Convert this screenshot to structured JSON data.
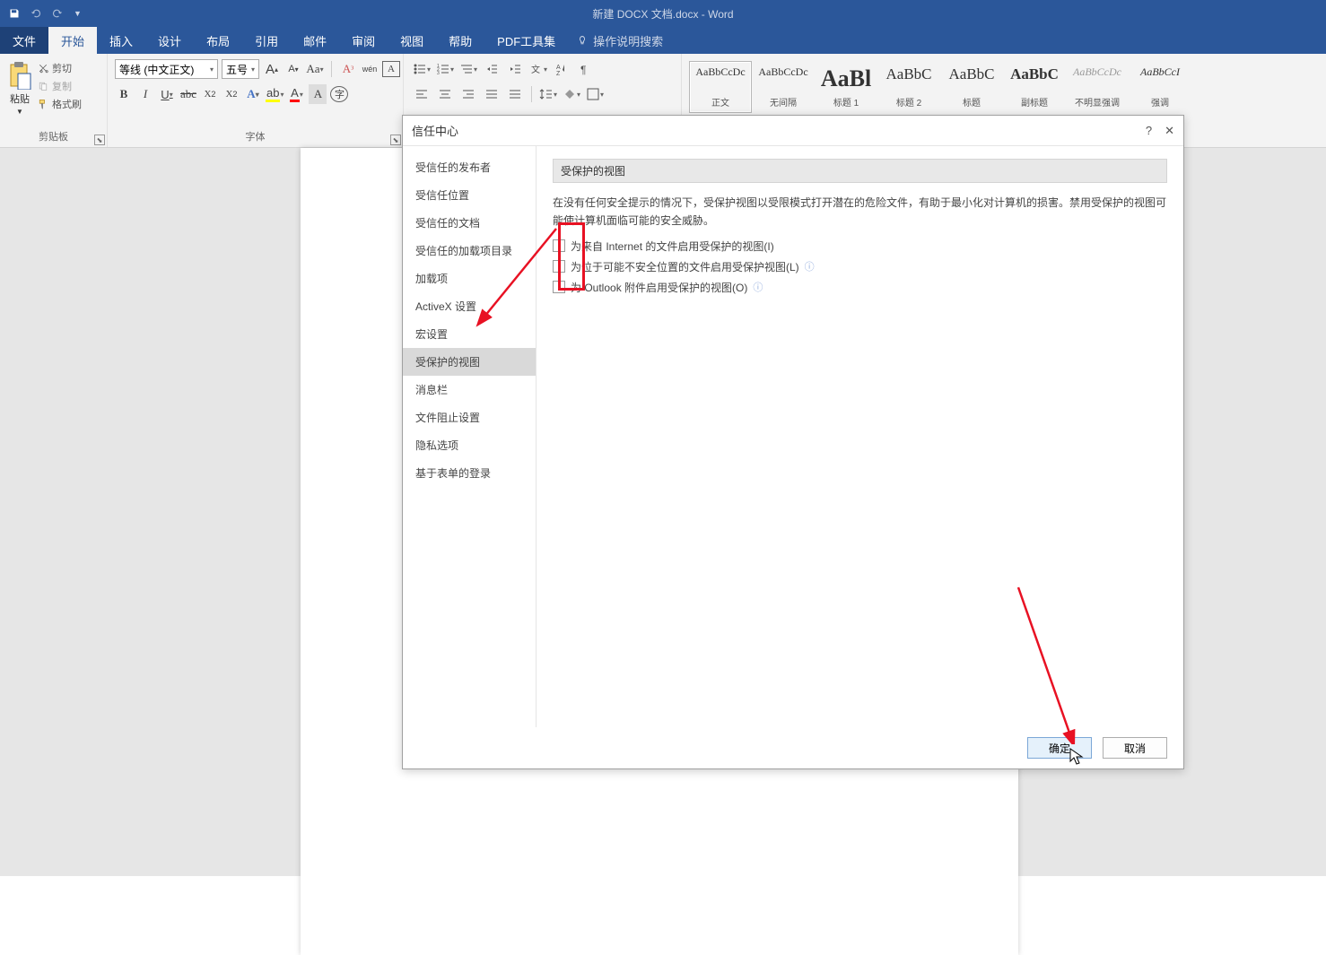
{
  "titlebar": {
    "document_title": "新建 DOCX 文档.docx  -  Word"
  },
  "tabs": {
    "file": "文件",
    "home": "开始",
    "insert": "插入",
    "design": "设计",
    "layout": "布局",
    "references": "引用",
    "mailings": "邮件",
    "review": "审阅",
    "view": "视图",
    "help": "帮助",
    "pdf": "PDF工具集",
    "search": "操作说明搜索"
  },
  "clipboard": {
    "paste": "粘贴",
    "cut": "剪切",
    "copy": "复制",
    "format_painter": "格式刷",
    "group": "剪贴板"
  },
  "font": {
    "name": "等线 (中文正文)",
    "size": "五号",
    "group": "字体",
    "bold": "B",
    "italic": "I",
    "underline": "U",
    "strike": "abc",
    "sub": "X₂",
    "sup": "X²",
    "clear": "A",
    "phonetic": "拼",
    "grow": "A",
    "shrink": "A",
    "case": "Aa",
    "charborder": "A",
    "highlight": "A",
    "fontcolor": "A"
  },
  "styles_gallery": [
    {
      "preview": "AaBbCcDc",
      "name": "正文",
      "cls": "sz12"
    },
    {
      "preview": "AaBbCcDc",
      "name": "无间隔",
      "cls": "sz12"
    },
    {
      "preview": "AaBl",
      "name": "标题 1",
      "cls": "sz26 bold"
    },
    {
      "preview": "AaBbC",
      "name": "标题 2",
      "cls": "sz17"
    },
    {
      "preview": "AaBbC",
      "name": "标题",
      "cls": "sz17"
    },
    {
      "preview": "AaBbC",
      "name": "副标题",
      "cls": "sz17 bold"
    },
    {
      "preview": "AaBbCcDc",
      "name": "不明显强调",
      "cls": "sz12 italic grey"
    },
    {
      "preview": "AaBbCcI",
      "name": "强调",
      "cls": "sz12 italic"
    }
  ],
  "dialog": {
    "title": "信任中心",
    "help": "?",
    "close": "✕",
    "sidebar": [
      "受信任的发布者",
      "受信任位置",
      "受信任的文档",
      "受信任的加载项目录",
      "加载项",
      "ActiveX 设置",
      "宏设置",
      "受保护的视图",
      "消息栏",
      "文件阻止设置",
      "隐私选项",
      "基于表单的登录"
    ],
    "sidebar_active_index": 7,
    "content_header": "受保护的视图",
    "content_desc": "在没有任何安全提示的情况下，受保护视图以受限模式打开潜在的危险文件，有助于最小化对计算机的损害。禁用受保护的视图可能使计算机面临可能的安全威胁。",
    "checks": [
      {
        "label": "为来自 Internet 的文件启用受保护的视图(I)",
        "info": false
      },
      {
        "label": "为位于可能不安全位置的文件启用受保护视图(L)",
        "info": true
      },
      {
        "label": "为 Outlook 附件启用受保护的视图(O)",
        "info": true
      }
    ],
    "ok": "确定",
    "cancel": "取消"
  }
}
